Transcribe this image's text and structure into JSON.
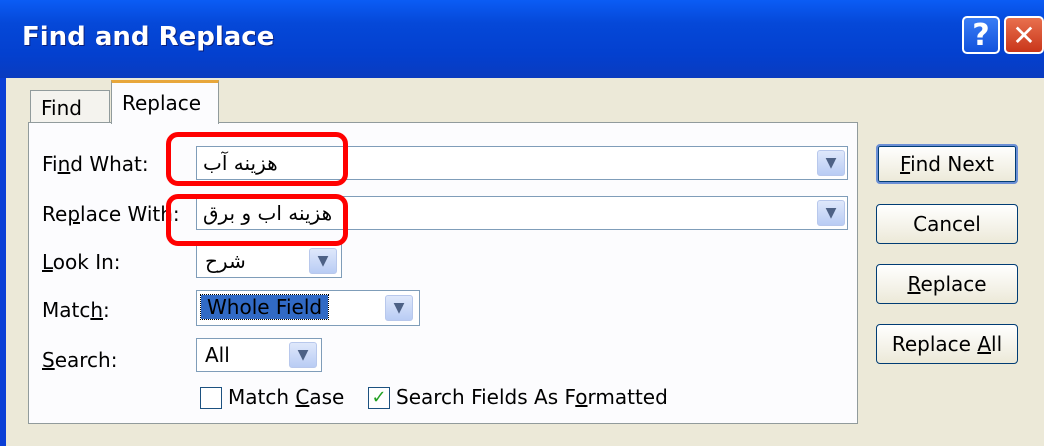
{
  "window": {
    "title": "Find and Replace",
    "help_glyph": "?",
    "close_glyph": "✕"
  },
  "tabs": [
    {
      "label": "Find"
    },
    {
      "label": "Replace"
    }
  ],
  "form": {
    "find_what": {
      "label_pre": "Fi",
      "label_u": "n",
      "label_post": "d What:",
      "value": "هزینه آب"
    },
    "replace_with": {
      "label_pre": "Re",
      "label_u": "p",
      "label_post": "lace With:",
      "value": "هزینه اب و برق"
    },
    "look_in": {
      "label_pre": "",
      "label_u": "L",
      "label_post": "ook In:",
      "value": "شرح"
    },
    "match": {
      "label_pre": "Matc",
      "label_u": "h",
      "label_post": ":",
      "value": "Whole Field"
    },
    "search": {
      "label_pre": "",
      "label_u": "S",
      "label_post": "earch:",
      "value": "All"
    },
    "match_case": {
      "label_pre": "Match ",
      "label_u": "C",
      "label_post": "ase",
      "checked": false
    },
    "search_formatted": {
      "label_pre": "Search Fields As F",
      "label_u": "o",
      "label_post": "rmatted",
      "checked": true
    }
  },
  "buttons": {
    "find_next": {
      "pre": "",
      "u": "F",
      "post": "ind Next"
    },
    "cancel": {
      "label": "Cancel"
    },
    "replace": {
      "pre": "",
      "u": "R",
      "post": "eplace"
    },
    "replace_all": {
      "pre": "Replace ",
      "u": "A",
      "post": "ll"
    }
  },
  "colors": {
    "titlebar": "#0548d8",
    "dialog": "#ece9d8",
    "highlight": "#ff0000",
    "selection": "#316ac5"
  },
  "icons": {
    "dropdown": "chevron-down-icon",
    "check": "checkmark-icon"
  }
}
